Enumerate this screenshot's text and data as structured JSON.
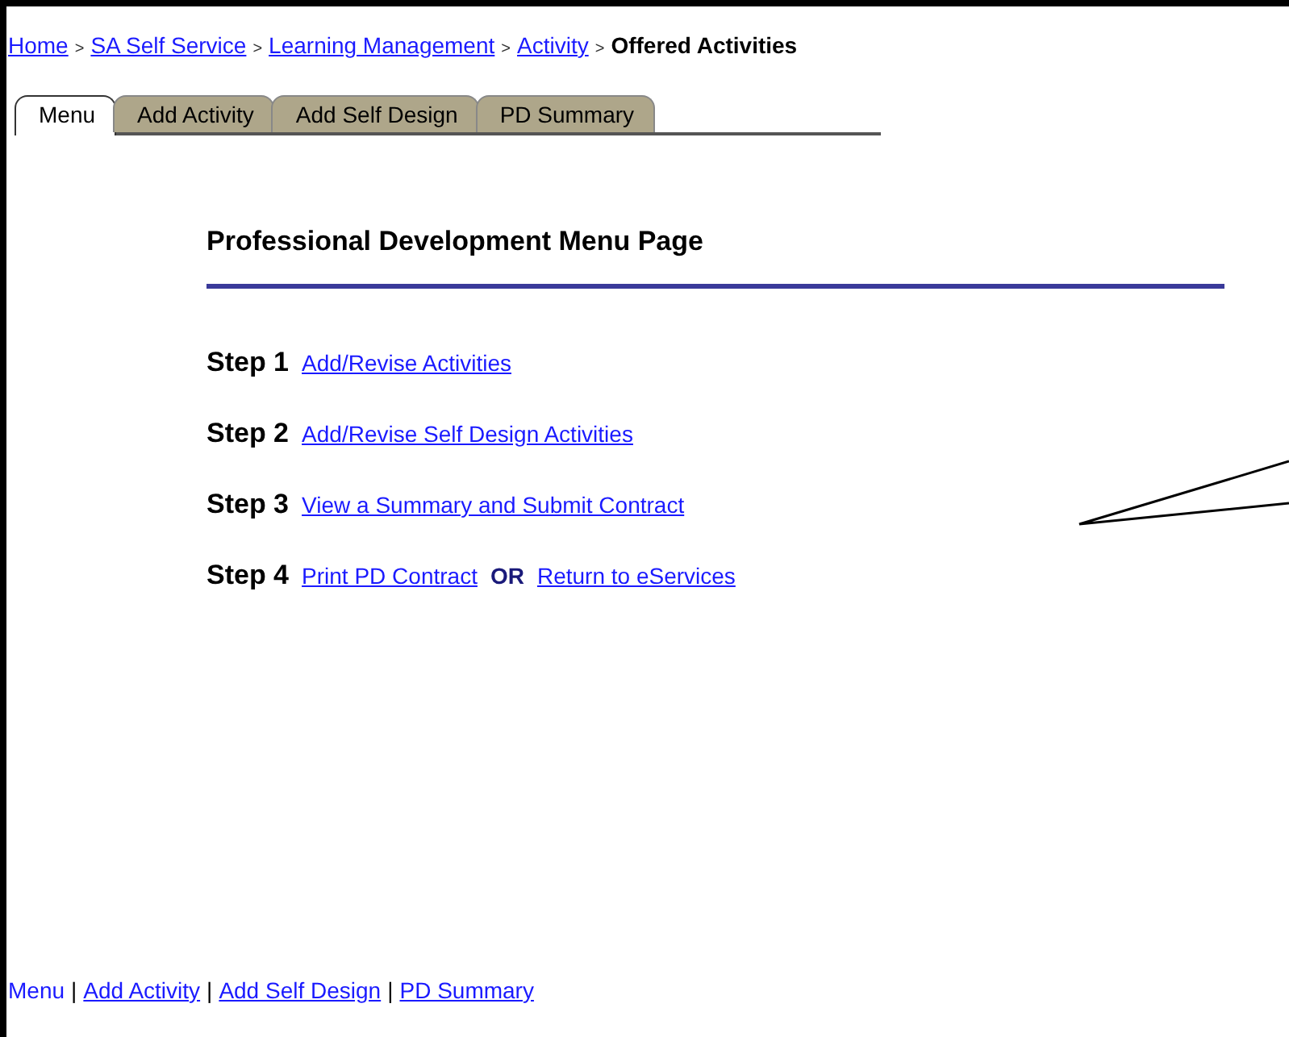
{
  "breadcrumb": [
    {
      "label": "Home",
      "kind": "link"
    },
    {
      "label": ">",
      "kind": "separator"
    },
    {
      "label": "SA Self Service",
      "kind": "link"
    },
    {
      "label": ">",
      "kind": "separator"
    },
    {
      "label": "Learning Management",
      "kind": "link"
    },
    {
      "label": ">",
      "kind": "separator"
    },
    {
      "label": "Activity",
      "kind": "link"
    },
    {
      "label": ">",
      "kind": "separator"
    },
    {
      "label": "Offered Activities",
      "kind": "current"
    }
  ],
  "tabs": [
    {
      "label": "Menu",
      "selected": true
    },
    {
      "label": "Add Activity",
      "selected": false
    },
    {
      "label": "Add Self Design",
      "selected": false
    },
    {
      "label": "PD Summary",
      "selected": false
    }
  ],
  "heading": "Professional Development Menu Page",
  "steps": [
    {
      "label": "Step 1",
      "links": [
        "Add/Revise Activities"
      ]
    },
    {
      "label": "Step 2",
      "links": [
        "Add/Revise Self Design Activities"
      ]
    },
    {
      "label": "Step 3",
      "links": [
        "View a Summary and Submit Contract"
      ]
    },
    {
      "label": "Step 4",
      "links": [
        "Print PD Contract",
        "Return to eServices"
      ],
      "joiner": "OR"
    }
  ],
  "footer_nav": [
    {
      "label": "Menu",
      "selected": true
    },
    {
      "label": "|",
      "kind": "separator"
    },
    {
      "label": "Add Activity",
      "selected": false
    },
    {
      "label": "|",
      "kind": "separator"
    },
    {
      "label": "Add Self Design",
      "selected": false
    },
    {
      "label": "|",
      "kind": "separator"
    },
    {
      "label": "PD Summary",
      "selected": false
    }
  ]
}
